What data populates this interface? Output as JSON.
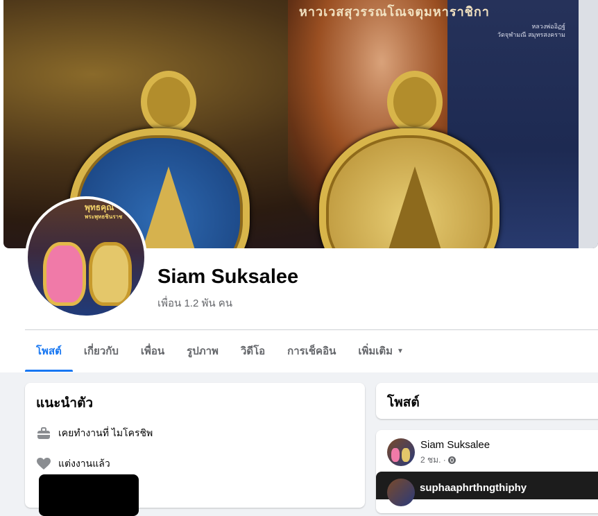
{
  "profile": {
    "name": "Siam Suksalee",
    "friends": "เพื่อน 1.2 พัน คน"
  },
  "cover": {
    "title_text": "หาวเวสสุวรรณโณจตุมหาราชิกา",
    "sub_line1": "หลวงพ่ออิฏฐ์",
    "sub_line2": "วัดจุฬามณี สมุทรสงคราม"
  },
  "avatar": {
    "text_line1": "พุทธคุณ",
    "text_line2": "พระพุทธชินราช"
  },
  "tabs": [
    {
      "label": "โพสต์",
      "active": true
    },
    {
      "label": "เกี่ยวกับ",
      "active": false
    },
    {
      "label": "เพื่อน",
      "active": false
    },
    {
      "label": "รูปภาพ",
      "active": false
    },
    {
      "label": "วิดีโอ",
      "active": false
    },
    {
      "label": "การเช็คอิน",
      "active": false
    },
    {
      "label": "เพิ่มเติม",
      "active": false
    }
  ],
  "intro": {
    "title": "แนะนำตัว",
    "work": "เคยทำงานที่ ไมโครชิพ",
    "relationship": "แต่งงานแล้ว"
  },
  "posts": {
    "title": "โพสต์",
    "first": {
      "author": "Siam Suksalee",
      "time": "2 ชม. ·"
    },
    "shared_author": "suphaaphrthngthiphy"
  },
  "colors": {
    "accent": "#1877f2",
    "secondary_text": "#65676b",
    "background": "#f0f2f5"
  }
}
